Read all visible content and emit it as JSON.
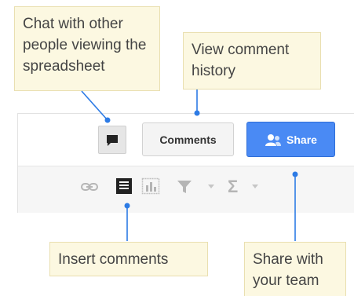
{
  "callouts": {
    "chat": "Chat with other people viewing the spreadsheet",
    "history": "View comment history",
    "insert": "Insert comments",
    "share": "Share with your team"
  },
  "toolbar": {
    "comments_label": "Comments",
    "share_label": "Share",
    "sigma_symbol": "Σ"
  },
  "icons": [
    "chat-icon",
    "person-icon",
    "link-icon",
    "comment-icon",
    "chart-icon",
    "filter-icon",
    "sigma-icon"
  ],
  "colors": {
    "callout_bg": "#fcf8e1",
    "connector": "#2d7be5",
    "share_button": "#4a8af4"
  }
}
